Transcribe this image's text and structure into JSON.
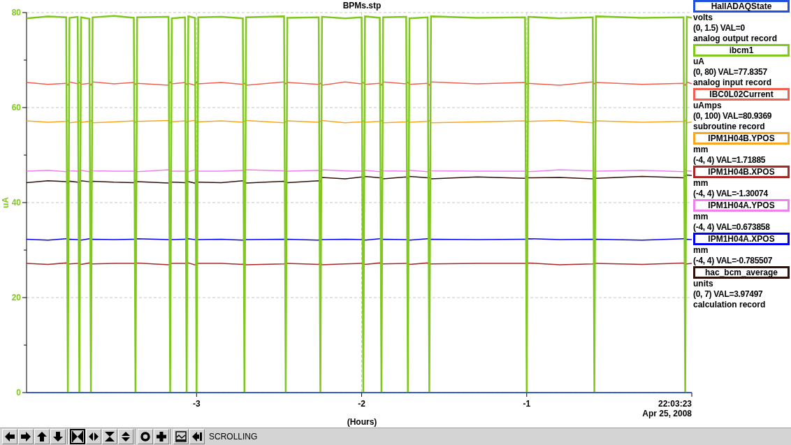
{
  "plot": {
    "chart_data": {
      "type": "line",
      "title": "BPMs.stp",
      "xlabel": "(Hours)",
      "ylabel": "uA",
      "xlim": [
        -4.03,
        0
      ],
      "ylim": [
        0,
        80
      ],
      "xticks": [
        -3,
        -2,
        -1
      ],
      "yticks": [
        0,
        20,
        40,
        60,
        80
      ],
      "grid": true,
      "x": [
        -4.03,
        -3.9,
        -3.79,
        -3.78,
        -3.77,
        -3.72,
        -3.71,
        -3.7,
        -3.65,
        -3.64,
        -3.63,
        -3.5,
        -3.38,
        -3.37,
        -3.36,
        -3.17,
        -3.16,
        -3.15,
        -3.07,
        -3.06,
        -3.05,
        -3.01,
        -3.0,
        -2.99,
        -2.85,
        -2.72,
        -2.71,
        -2.7,
        -2.47,
        -2.46,
        -2.45,
        -2.26,
        -2.25,
        -2.24,
        -2.1,
        -2.0,
        -1.99,
        -1.98,
        -1.89,
        -1.88,
        -1.87,
        -1.73,
        -1.72,
        -1.71,
        -1.6,
        -1.59,
        -1.58,
        -1.3,
        -1.01,
        -1.0,
        -0.99,
        -0.8,
        -0.6,
        -0.59,
        -0.58,
        -0.3,
        -0.05,
        -0.04,
        -0.03,
        0
      ],
      "series": [
        {
          "name": "HallADAQState",
          "color": "#2050e0",
          "values": [
            0,
            0,
            0,
            0,
            0,
            0,
            0,
            0,
            0,
            0,
            0,
            0,
            0,
            0,
            0,
            0,
            0,
            0,
            0,
            0,
            0,
            0,
            0,
            0,
            0,
            0,
            0,
            0,
            0,
            0,
            0,
            0,
            0,
            0,
            0,
            0,
            0,
            0,
            0,
            0,
            0,
            0,
            0,
            0,
            0,
            0,
            0,
            0,
            0,
            0,
            0,
            0,
            0,
            0,
            0,
            0,
            0,
            0,
            0,
            0
          ]
        },
        {
          "name": "ibcm1",
          "color": "#80c820",
          "values": [
            78.8,
            79.2,
            79,
            0,
            78.9,
            79.1,
            0,
            79,
            78.7,
            0,
            79,
            79.3,
            78.9,
            0,
            79,
            79.1,
            0,
            78.8,
            79,
            0,
            79.2,
            78.9,
            0,
            79,
            79.1,
            78.8,
            0,
            79,
            79.2,
            0,
            78.9,
            79,
            0,
            79.1,
            78.8,
            79,
            0,
            79.2,
            78.9,
            0,
            79,
            79.1,
            0,
            78.8,
            79,
            0,
            79.2,
            78.9,
            79,
            0,
            79.1,
            78.8,
            79,
            0,
            79.2,
            78.9,
            79,
            0,
            79.1,
            78.9
          ]
        },
        {
          "name": "IBC0L02Current",
          "color": "#f06050",
          "values": [
            65.3,
            64.9,
            65.1,
            64.7,
            65.4,
            65.0,
            65.3,
            64.9,
            65.1,
            64.7,
            65.4,
            65.0,
            65.3,
            64.9,
            65.1,
            64.7,
            65.4,
            65.0,
            65.3,
            64.9,
            65.1,
            64.7,
            65.4,
            65.0,
            65.3,
            64.9,
            65.1,
            64.7,
            65.4,
            65.0,
            65.3,
            64.9,
            65.1,
            64.7,
            65.4,
            65.0,
            65.3,
            64.9,
            65.1,
            64.7,
            65.4,
            65.0,
            65.3,
            64.9,
            65.1,
            64.7,
            65.4,
            65.0,
            65.3,
            64.9,
            65.1,
            64.7,
            65.4,
            65.0,
            65.3,
            64.9,
            65.1,
            64.7,
            65.4,
            65.0
          ]
        },
        {
          "name": "IPM1H04B.YPOS",
          "color": "#f8a820",
          "values": [
            57.2,
            56.9,
            57.1,
            57.3,
            56.8,
            57.0,
            57.2,
            56.9,
            57.1,
            57.3,
            56.8,
            57.0,
            57.2,
            56.9,
            57.1,
            57.3,
            56.8,
            57.0,
            57.2,
            56.9,
            57.1,
            57.3,
            56.8,
            57.0,
            57.2,
            56.9,
            57.1,
            57.3,
            56.8,
            57.0,
            57.2,
            56.9,
            57.1,
            57.3,
            56.8,
            57.0,
            57.2,
            56.9,
            57.1,
            57.3,
            56.8,
            57.0,
            57.2,
            56.9,
            57.1,
            57.3,
            56.8,
            57.0,
            57.2,
            56.9,
            57.1,
            57.3,
            56.8,
            57.0,
            57.2,
            56.9,
            57.1,
            57.3,
            56.8,
            57.0
          ]
        },
        {
          "name": "IPM1H04B.XPOS",
          "color": "#a82828",
          "values": [
            27.2,
            27.0,
            27.3,
            26.9,
            27.1,
            27.2,
            27.2,
            27.0,
            27.3,
            26.9,
            27.1,
            27.2,
            27.2,
            27.0,
            27.3,
            26.9,
            27.1,
            27.2,
            27.2,
            27.0,
            27.3,
            26.9,
            27.1,
            27.2,
            27.2,
            27.0,
            27.3,
            26.9,
            27.1,
            27.2,
            27.2,
            27.0,
            27.3,
            26.9,
            27.1,
            27.2,
            27.2,
            27.0,
            27.3,
            26.9,
            27.1,
            27.2,
            27.2,
            27.0,
            27.3,
            26.9,
            27.1,
            27.2,
            27.2,
            27.0,
            27.3,
            26.9,
            27.1,
            27.2,
            27.2,
            27.0,
            27.3,
            26.9,
            27.1,
            27.2
          ]
        },
        {
          "name": "IPM1H04A.YPOS",
          "color": "#f080f0",
          "values": [
            46.6,
            46.8,
            46.5,
            46.9,
            46.7,
            46.6,
            46.6,
            46.8,
            46.5,
            46.9,
            46.7,
            46.6,
            46.6,
            46.8,
            46.5,
            46.9,
            46.7,
            46.6,
            46.6,
            46.8,
            46.5,
            46.9,
            46.7,
            46.6,
            46.6,
            46.8,
            46.5,
            46.9,
            46.7,
            46.6,
            46.6,
            46.8,
            46.5,
            46.9,
            46.7,
            46.6,
            46.6,
            46.8,
            46.5,
            46.9,
            46.7,
            46.6,
            46.6,
            46.8,
            46.5,
            46.9,
            46.7,
            46.6,
            46.6,
            46.8,
            46.5,
            46.9,
            46.7,
            46.6,
            46.6,
            46.8,
            46.5,
            46.9,
            46.7,
            46.6
          ]
        },
        {
          "name": "IPM1H04A.XPOS",
          "color": "#0000f0",
          "values": [
            32.3,
            32.1,
            32.4,
            32.2,
            32.3,
            32.2,
            32.3,
            32.1,
            32.4,
            32.2,
            32.3,
            32.2,
            32.3,
            32.1,
            32.4,
            32.2,
            32.3,
            32.2,
            32.3,
            32.1,
            32.4,
            32.2,
            32.3,
            32.2,
            32.3,
            32.1,
            32.4,
            32.2,
            32.3,
            32.2,
            32.3,
            32.1,
            32.4,
            32.2,
            32.3,
            32.2,
            32.3,
            32.1,
            32.4,
            32.2,
            32.3,
            32.2,
            32.3,
            32.1,
            32.4,
            32.2,
            32.3,
            32.2,
            32.3,
            32.1,
            32.4,
            32.2,
            32.3,
            32.2,
            32.3,
            32.1,
            32.4,
            32.2,
            32.3,
            32.2
          ]
        },
        {
          "name": "hac_bcm_average",
          "color": "#301008",
          "values": [
            44.2,
            44.6,
            44.4,
            44.1,
            44.5,
            44.3,
            44.2,
            44.6,
            44.4,
            44.1,
            44.5,
            44.3,
            44.2,
            44.6,
            44.4,
            44.1,
            44.5,
            44.3,
            44.2,
            44.6,
            44.4,
            44.1,
            44.5,
            44.3,
            44.2,
            44.6,
            44.4,
            44.1,
            44.5,
            44.3,
            44.2,
            44.6,
            44.4,
            45.3,
            45.0,
            45.4,
            45.1,
            45.5,
            45.2,
            45.3,
            45.0,
            45.4,
            45.1,
            45.5,
            45.2,
            45.3,
            45.0,
            45.4,
            45.1,
            45.5,
            45.2,
            45.3,
            45.0,
            45.4,
            45.1,
            45.5,
            45.2,
            45.6,
            45.8,
            45.7
          ]
        }
      ]
    },
    "end_time": "22:03:23",
    "end_date": "Apr 25, 2008"
  },
  "legend": [
    {
      "units": "volts",
      "range": "(0, 1.5) VAL=0",
      "record": "analog output record"
    },
    {
      "units": "uA",
      "range": "(0, 80) VAL=77.8357",
      "record": "analog input record"
    },
    {
      "units": "uAmps",
      "range": "(0, 100) VAL=80.9369",
      "record": "subroutine record"
    },
    {
      "units": "mm",
      "range": "(-4, 4) VAL=1.71885"
    },
    {
      "units": "mm",
      "range": "(-4, 4) VAL=-1.30074"
    },
    {
      "units": "mm",
      "range": "(-4, 4) VAL=0.673858"
    },
    {
      "units": "mm",
      "range": "(-4, 4) VAL=-0.785507"
    },
    {
      "units": "units",
      "range": "(0, 7) VAL=3.97497",
      "record": "calculation record"
    }
  ],
  "toolbar": {
    "buttons": [
      {
        "kind": "pan-left",
        "selected": false
      },
      {
        "kind": "pan-right",
        "selected": false
      },
      {
        "kind": "pan-up",
        "selected": false
      },
      {
        "kind": "pan-down",
        "selected": false
      },
      {
        "kind": "zoom-in-x",
        "selected": true
      },
      {
        "kind": "zoom-out-x",
        "selected": false
      },
      {
        "kind": "zoom-in-y",
        "selected": false
      },
      {
        "kind": "zoom-out-y",
        "selected": false
      },
      {
        "kind": "reset",
        "selected": false
      },
      {
        "kind": "add",
        "selected": false
      },
      {
        "kind": "graph",
        "selected": false
      },
      {
        "kind": "back",
        "selected": false
      }
    ],
    "mode": "SCROLLING"
  }
}
